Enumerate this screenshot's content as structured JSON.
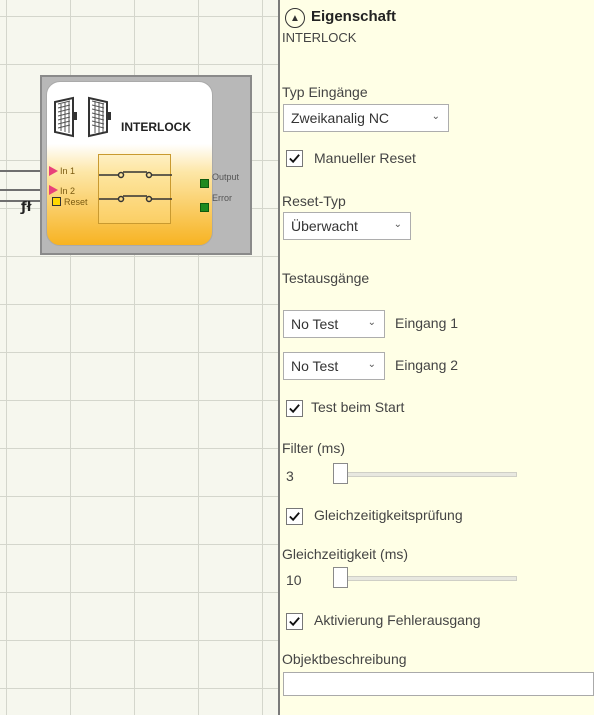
{
  "canvas": {
    "block_title": "INTERLOCK",
    "inputs": [
      "In 1",
      "In 2",
      "Reset"
    ],
    "outputs": [
      "Output",
      "Error"
    ],
    "pulse_symbol": "ƒł"
  },
  "properties": {
    "header_title": "Eigenschaft",
    "header_icon": "chevron-up-icon",
    "block_type": "INTERLOCK",
    "typ_eingaenge_label": "Typ Eingänge",
    "typ_eingaenge_value": "Zweikanalig NC",
    "manueller_reset_label": "Manueller Reset",
    "manueller_reset_checked": true,
    "reset_typ_label": "Reset-Typ",
    "reset_typ_value": "Überwacht",
    "testausgaenge_label": "Testausgänge",
    "test1_value": "No Test",
    "test1_label": "Eingang 1",
    "test2_value": "No Test",
    "test2_label": "Eingang 2",
    "test_beim_start_label": "Test beim Start",
    "test_beim_start_checked": true,
    "filter_label": "Filter (ms)",
    "filter_value": "3",
    "gleichzeitigkeitspruefung_label": "Gleichzeitigkeitsprüfung",
    "gleichzeitigkeitspruefung_checked": true,
    "gleichzeitigkeit_label": "Gleichzeitigkeit (ms)",
    "gleichzeitigkeit_value": "10",
    "fehlerausgang_label": "Aktivierung Fehlerausgang",
    "fehlerausgang_checked": true,
    "objektbeschreibung_label": "Objektbeschreibung",
    "objektbeschreibung_value": ""
  },
  "colors": {
    "panel_bg": "#ffffe6",
    "canvas_bg": "#f6f7ee",
    "block_orange": "#f7b322",
    "input_arrow": "#e8417a",
    "output_port": "#1f8a1f",
    "reset_port": "#ffd800"
  }
}
